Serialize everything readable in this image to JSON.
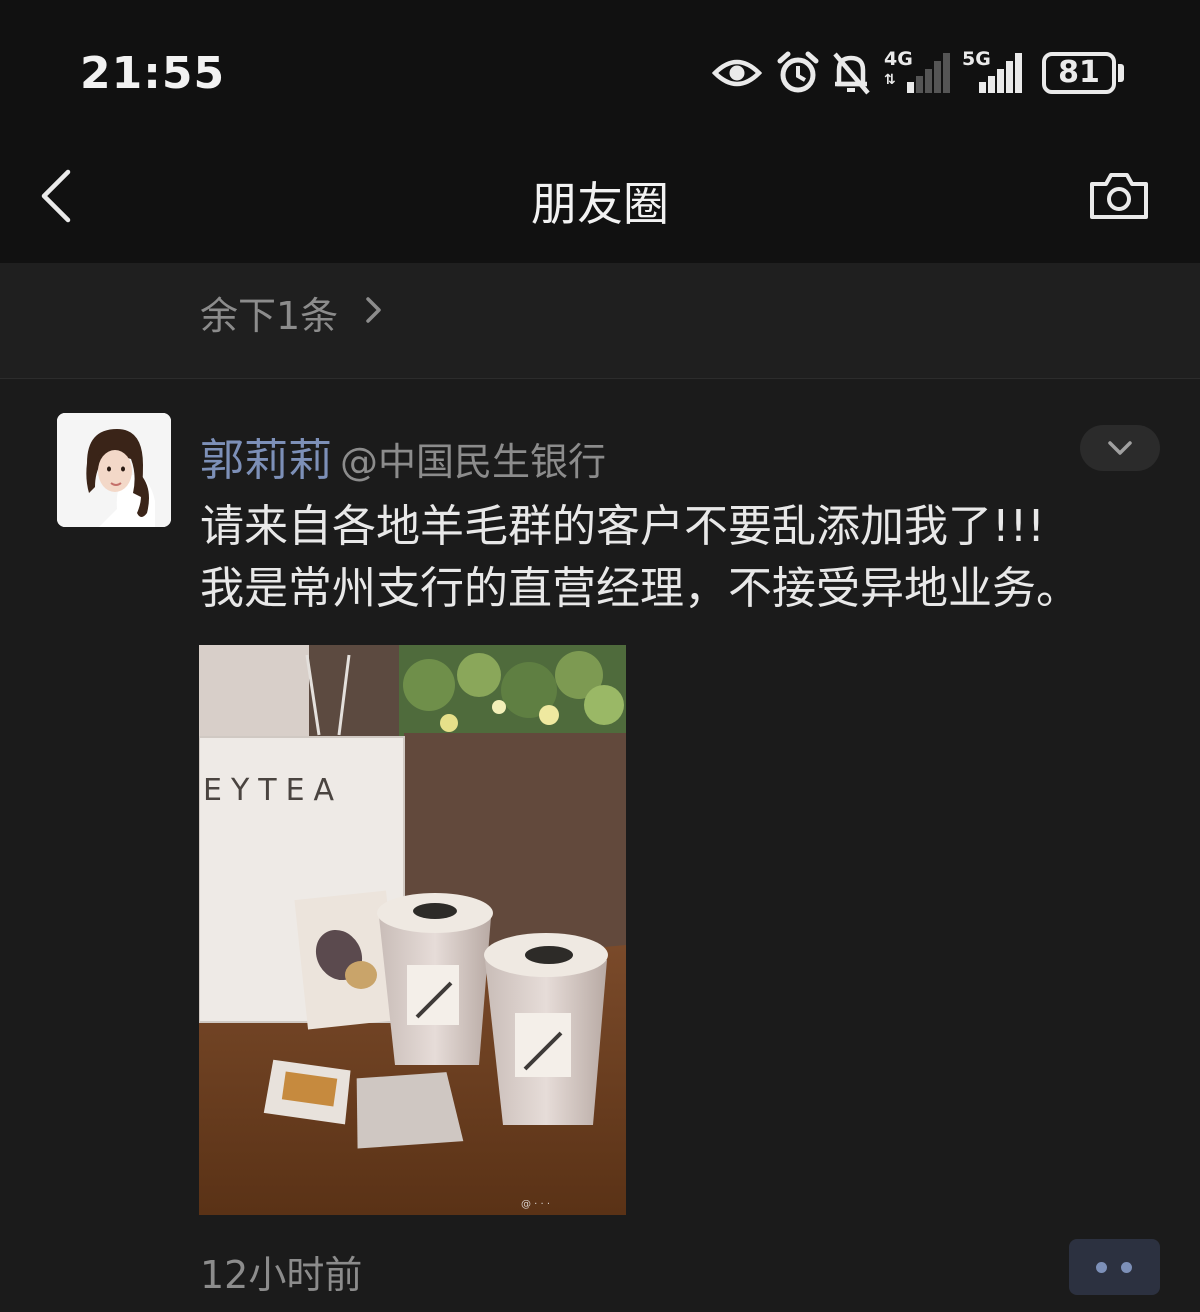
{
  "status_bar": {
    "time": "21:55",
    "icons": [
      "eye-icon",
      "alarm-icon",
      "mute-icon",
      "4g-signal-icon",
      "5g-signal-icon",
      "battery-icon"
    ],
    "network_4g": "4G",
    "network_5g": "5G",
    "battery": "81"
  },
  "nav": {
    "back_icon": "back-chevron-icon",
    "title": "朋友圈",
    "camera_icon": "camera-icon"
  },
  "remaining": {
    "label": "余下1条",
    "icon": "chevron-right-icon"
  },
  "post": {
    "username": "郭莉莉",
    "company": "@中国民生银行",
    "text_line1": "请来自各地羊毛群的客户不要乱添加我了!!!",
    "text_line2": "我是常州支行的直营经理，不接受异地业务。",
    "photo_brand_text": "EYTEA",
    "timestamp": "12小时前",
    "collapse_icon": "chevron-down-icon",
    "more_icon": "more-dots-icon"
  },
  "colors": {
    "background": "#1b1b1b",
    "bar_background": "#111111",
    "username": "#7d90b8",
    "secondary_text": "#8c8c8c"
  }
}
